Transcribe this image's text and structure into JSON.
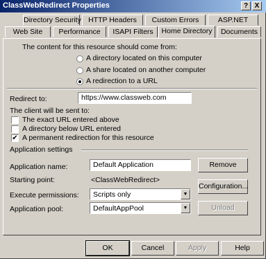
{
  "window": {
    "title": "ClassWebRedirect Properties",
    "help_button": "?",
    "close_button": "X"
  },
  "tabs_row1": [
    "Directory Security",
    "HTTP Headers",
    "Custom Errors",
    "ASP.NET"
  ],
  "tabs_row2": [
    "Web Site",
    "Performance",
    "ISAPI Filters",
    "Home Directory",
    "Documents"
  ],
  "active_tab": "Home Directory",
  "content_source": {
    "heading": "The content for this resource should come from:",
    "options": [
      "A directory located on this computer",
      "A share located on another computer",
      "A redirection to a URL"
    ],
    "selected": "A redirection to a URL"
  },
  "redirect": {
    "label": "Redirect to:",
    "value": "https://www.classweb.com"
  },
  "client_sent": {
    "heading": "The client will be sent to:",
    "options": [
      {
        "label": "The exact URL entered above",
        "checked": false
      },
      {
        "label": "A directory below URL entered",
        "checked": false
      },
      {
        "label": "A permanent redirection for this resource",
        "checked": true
      }
    ]
  },
  "app_settings": {
    "heading": "Application settings",
    "name_label": "Application name:",
    "name_value": "Default Application",
    "remove_button": "Remove",
    "starting_point_label": "Starting point:",
    "starting_point_value": "<ClassWebRedirect>",
    "configuration_button": "Configuration...",
    "execute_label": "Execute permissions:",
    "execute_value": "Scripts only",
    "pool_label": "Application pool:",
    "pool_value": "DefaultAppPool",
    "unload_button": "Unload"
  },
  "footer": {
    "ok": "OK",
    "cancel": "Cancel",
    "apply": "Apply",
    "help": "Help"
  },
  "check_mark": "✔",
  "arrow_glyph": "▼"
}
